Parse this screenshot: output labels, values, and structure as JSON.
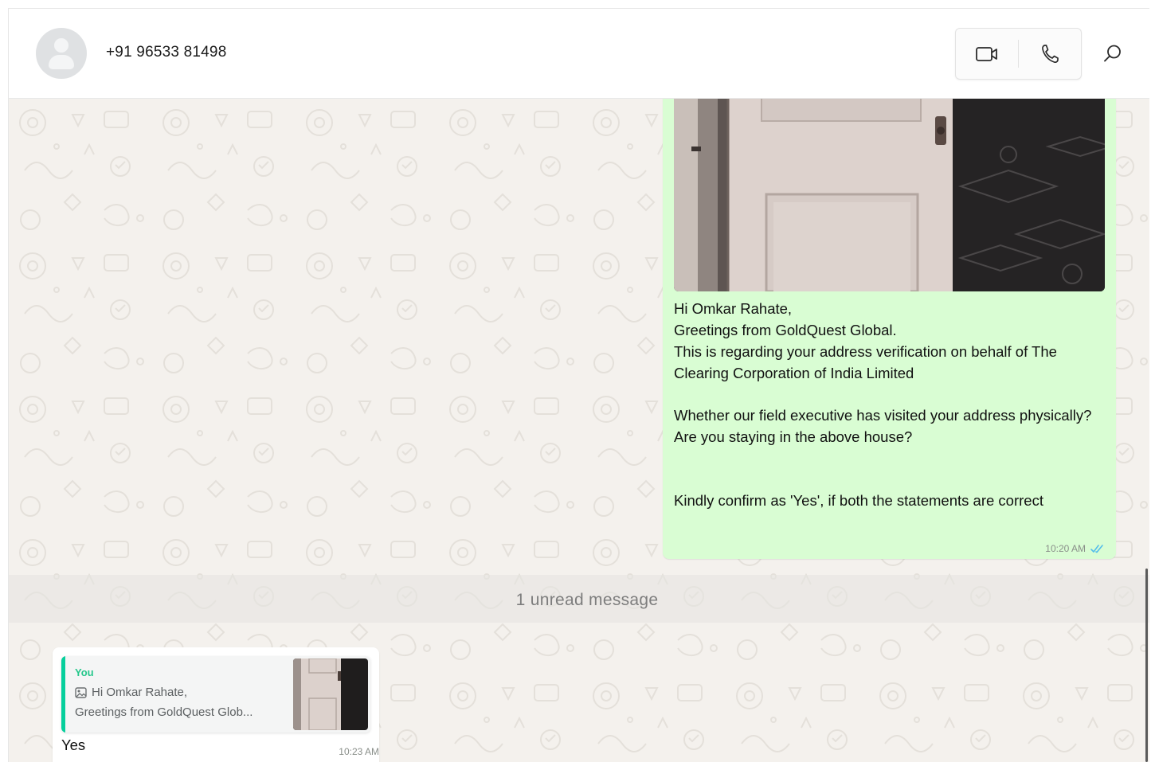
{
  "header": {
    "contact_name": "+91 96533 81498",
    "icons": {
      "avatar": "default-avatar-icon",
      "video": "video-call-icon",
      "voice": "voice-call-icon",
      "search": "search-icon"
    }
  },
  "messages": {
    "outgoing": {
      "image": "house-door-photo",
      "lines": [
        "Hi Omkar Rahate,",
        "Greetings from GoldQuest Global.",
        "This is regarding your address verification on behalf of The Clearing Corporation of India Limited",
        "Whether our field executive has visited your address physically?",
        "Are you staying in the above house?",
        "Kindly confirm as 'Yes', if both the statements are correct"
      ],
      "time": "10:20 AM",
      "status_icon": "double-tick-read-icon"
    },
    "unread_banner": "1 unread message",
    "incoming": {
      "quote": {
        "author": "You",
        "line1": "Hi Omkar Rahate,",
        "line2": "Greetings from GoldQuest Glob...",
        "icon": "photo-icon"
      },
      "text": "Yes",
      "time": "10:23 AM"
    }
  },
  "colors": {
    "outgoing_bubble": "#d9fdd3",
    "incoming_bubble": "#ffffff",
    "chat_background": "#f4f1ed",
    "quote_accent": "#06cf9c",
    "read_tick": "#53bdeb"
  }
}
